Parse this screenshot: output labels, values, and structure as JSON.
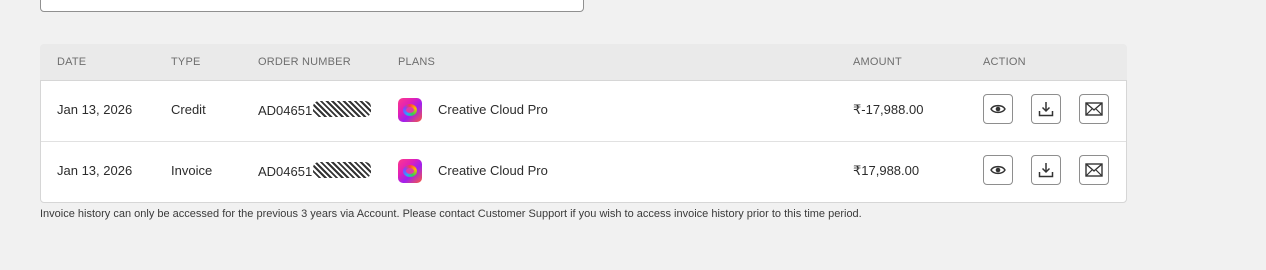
{
  "table": {
    "headers": {
      "date": "DATE",
      "type": "TYPE",
      "order_number": "ORDER NUMBER",
      "plans": "PLANS",
      "amount": "AMOUNT",
      "action": "ACTION"
    },
    "rows": [
      {
        "date": "Jan 13, 2026",
        "type": "Credit",
        "order_number": "AD04651",
        "plan": "Creative Cloud Pro",
        "amount": "₹-17,988.00"
      },
      {
        "date": "Jan 13, 2026",
        "type": "Invoice",
        "order_number": "AD04651",
        "plan": "Creative Cloud Pro",
        "amount": "₹17,988.00"
      }
    ],
    "actions": [
      "eye-icon",
      "download-icon",
      "mail-icon"
    ]
  },
  "footnote": "Invoice history can only be accessed for the previous 3 years via Account. Please contact Customer Support if you wish to access invoice history prior to this time period."
}
